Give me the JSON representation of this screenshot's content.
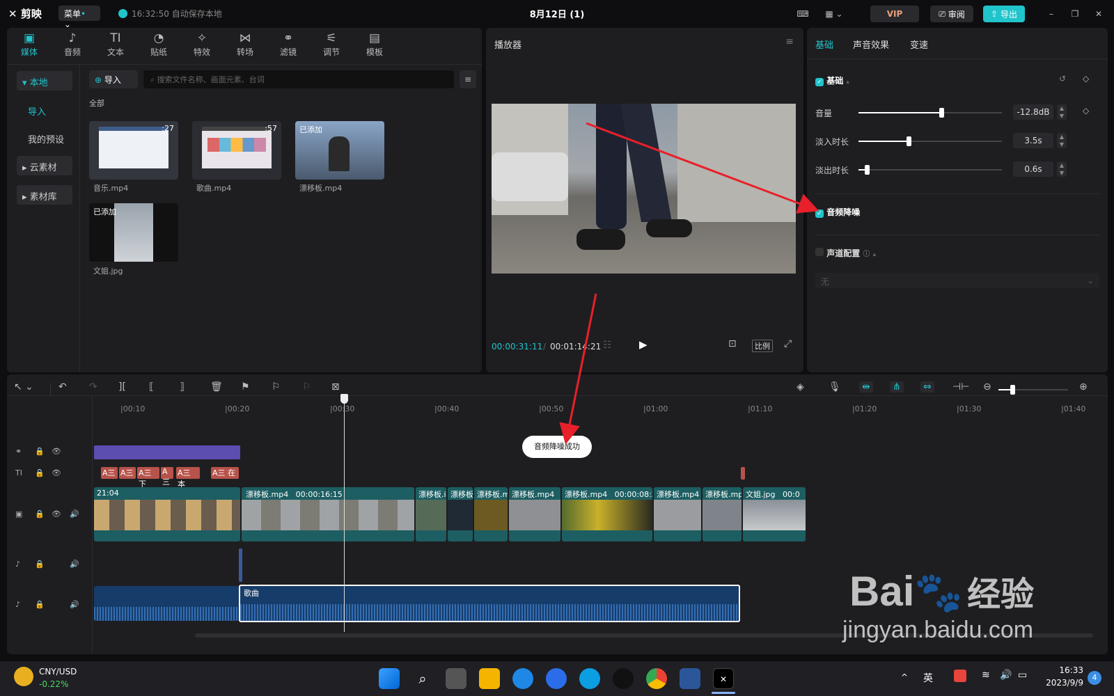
{
  "titlebar": {
    "logo": "剪映",
    "menu_label": "菜单",
    "save_status": "16:32:50 自动保存本地",
    "project_title": "8月12日 (1)",
    "vip_label": "VIP",
    "review_label": "审阅",
    "export_label": "导出"
  },
  "media": {
    "tools": [
      {
        "label": "媒体",
        "icon": "media-icon"
      },
      {
        "label": "音频",
        "icon": "audio-icon"
      },
      {
        "label": "文本",
        "icon": "text-icon"
      },
      {
        "label": "贴纸",
        "icon": "sticker-icon"
      },
      {
        "label": "特效",
        "icon": "effects-icon"
      },
      {
        "label": "转场",
        "icon": "transition-icon"
      },
      {
        "label": "滤镜",
        "icon": "filter-icon"
      },
      {
        "label": "调节",
        "icon": "adjust-icon"
      },
      {
        "label": "模板",
        "icon": "template-icon"
      }
    ],
    "sidebar": [
      "本地",
      "导入",
      "我的预设",
      "云素材",
      "素材库"
    ],
    "import_label": "导入",
    "search_placeholder": "搜索文件名称、画面元素、台词",
    "filter_label": "全部",
    "items": [
      {
        "name": "音乐.mp4",
        "duration": ":27",
        "added": ""
      },
      {
        "name": "歌曲.mp4",
        "duration": ":57",
        "added": ""
      },
      {
        "name": "漂移板.mp4",
        "duration": "",
        "added": "已添加"
      },
      {
        "name": "文姐.jpg",
        "duration": "",
        "added": "已添加"
      }
    ]
  },
  "player": {
    "title": "播放器",
    "current_time": "00:00:31:11",
    "total_time": "00:01:14:21",
    "ratio_label": "比例"
  },
  "props": {
    "tabs": [
      "基础",
      "声音效果",
      "变速"
    ],
    "section_basic": "基础",
    "volume_label": "音量",
    "volume_value": "-12.8dB",
    "volume_level": 0.58,
    "fadein_label": "淡入时长",
    "fadein_value": "3.5s",
    "fadein_level": 0.35,
    "fadeout_label": "淡出时长",
    "fadeout_value": "0.6s",
    "fadeout_level": 0.06,
    "denoise_label": "音频降噪",
    "channel_label": "声道配置",
    "channel_value": "无"
  },
  "timeline": {
    "ruler": [
      "|00:10",
      "|00:20",
      "|00:30",
      "|00:40",
      "|00:50",
      "|01:00",
      "|01:10",
      "|01:20",
      "|01:30",
      "|01:40"
    ],
    "text_clips": [
      "A三",
      "A三",
      "A三 下",
      "A三",
      "A三 本",
      "A三 在泛"
    ],
    "video_clips": [
      {
        "label": "21:04"
      },
      {
        "label": "漂移板.mp4   00:00:16:15"
      },
      {
        "label": "漂移板.i"
      },
      {
        "label": "漂移板"
      },
      {
        "label": "漂移板.m"
      },
      {
        "label": "漂移板.mp4"
      },
      {
        "label": "漂移板.mp4   00:00:08:25"
      },
      {
        "label": "漂移板.mp4"
      },
      {
        "label": "漂移板.mp"
      },
      {
        "label": "文姐.jpg   00:0"
      }
    ],
    "audio_clip_label": "歌曲",
    "toast": "音频降噪成功"
  },
  "taskbar": {
    "currency_pair": "CNY/USD",
    "currency_change": "-0.22%",
    "ime": "英",
    "time": "16:33",
    "date": "2023/9/9",
    "notification_count": "4"
  },
  "watermark": {
    "brand": "Bai",
    "brand2": "经验",
    "url": "jingyan.baidu.com"
  },
  "colors": {
    "accent": "#20c4cb",
    "annotation": "#e8202a",
    "clip_teal": "#1d5e62",
    "audio_blue": "#163c6a"
  }
}
